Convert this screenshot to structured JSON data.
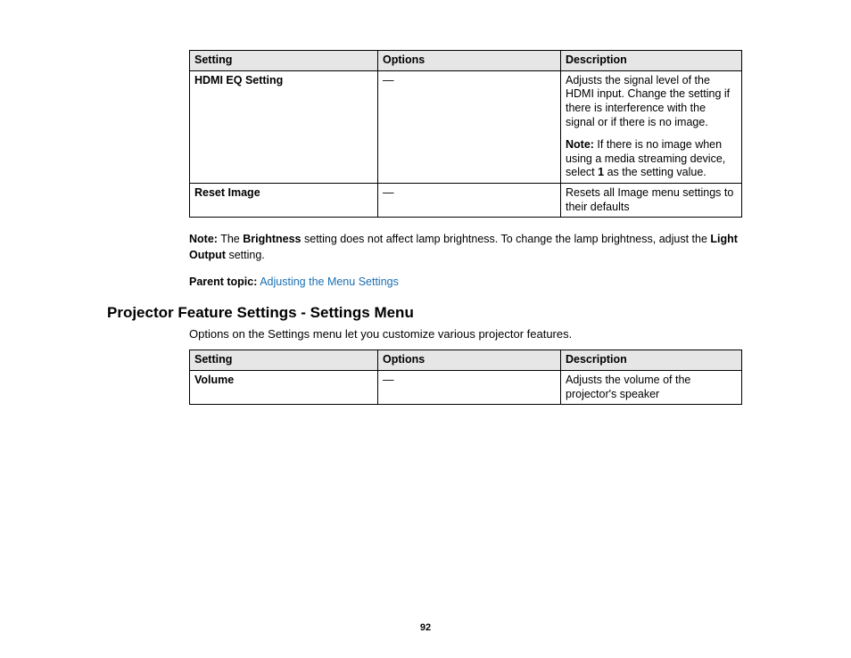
{
  "table1": {
    "headers": {
      "setting": "Setting",
      "options": "Options",
      "description": "Description"
    },
    "rows": [
      {
        "setting": "HDMI EQ Setting",
        "options": "—",
        "desc_p1": "Adjusts the signal level of the HDMI input. Change the setting if there is interference with the signal or if there is no image.",
        "desc_note_label": "Note:",
        "desc_note_rest": " If there is no image when using a media streaming device, select ",
        "desc_note_value": "1",
        "desc_note_tail": " as the setting value."
      },
      {
        "setting": "Reset Image",
        "options": "—",
        "desc_p1": "Resets all Image menu settings to their defaults"
      }
    ]
  },
  "note_paragraph": {
    "label": "Note:",
    "part1": " The ",
    "bold1": "Brightness",
    "part2": " setting does not affect lamp brightness. To change the lamp brightness, adjust the ",
    "bold2": "Light Output",
    "part3": " setting."
  },
  "parent_topic": {
    "label": "Parent topic:",
    "link_text": "Adjusting the Menu Settings"
  },
  "section_heading": "Projector Feature Settings - Settings Menu",
  "intro_text": "Options on the Settings menu let you customize various projector features.",
  "table2": {
    "headers": {
      "setting": "Setting",
      "options": "Options",
      "description": "Description"
    },
    "rows": [
      {
        "setting": "Volume",
        "options": "—",
        "desc_p1": "Adjusts the volume of the projector's speaker"
      }
    ]
  },
  "page_number": "92"
}
